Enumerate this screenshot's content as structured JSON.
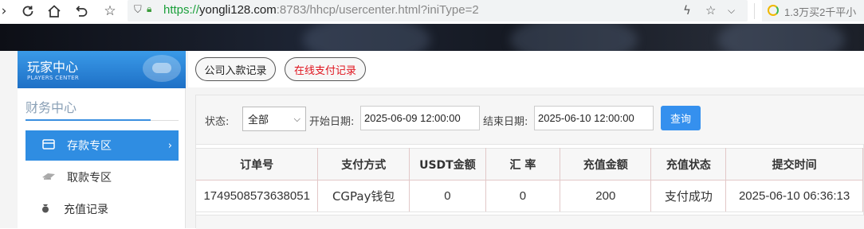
{
  "browser": {
    "url_protocol": "https://",
    "url_host": "yongli128.com",
    "url_rest": ":8783/hhcp/usercenter.html?iniType=2",
    "search_suggestion": "1.3万买2千平小"
  },
  "sidebar": {
    "header_title": "玩家中心",
    "header_subtitle": "PLAYERS CENTER",
    "section_title": "财务中心",
    "items": [
      {
        "label": "存款专区",
        "icon": "card-icon",
        "active": true
      },
      {
        "label": "取款专区",
        "icon": "money-icon",
        "active": false
      },
      {
        "label": "充值记录",
        "icon": "bag-icon",
        "active": false
      }
    ]
  },
  "tabs": [
    {
      "label": "公司入款记录"
    },
    {
      "label": "在线支付记录"
    }
  ],
  "filter": {
    "status_label": "状态:",
    "status_value": "全部",
    "start_label": "开始日期:",
    "start_value": "2025-06-09 12:00:00",
    "end_label": "结束日期:",
    "end_value": "2025-06-10 12:00:00",
    "query_button": "查询"
  },
  "table": {
    "headers": [
      "订单号",
      "支付方式",
      "USDT金额",
      "汇 率",
      "充值金额",
      "充值状态",
      "提交时间"
    ],
    "rows": [
      [
        "1749508573638051",
        "CGPay钱包",
        "0",
        "0",
        "200",
        "支付成功",
        "2025-06-10 06:36:13"
      ]
    ]
  },
  "colors": {
    "accent": "#2f8de2",
    "url_green": "#1a9f3a",
    "active_tab_text": "#e0141e"
  }
}
